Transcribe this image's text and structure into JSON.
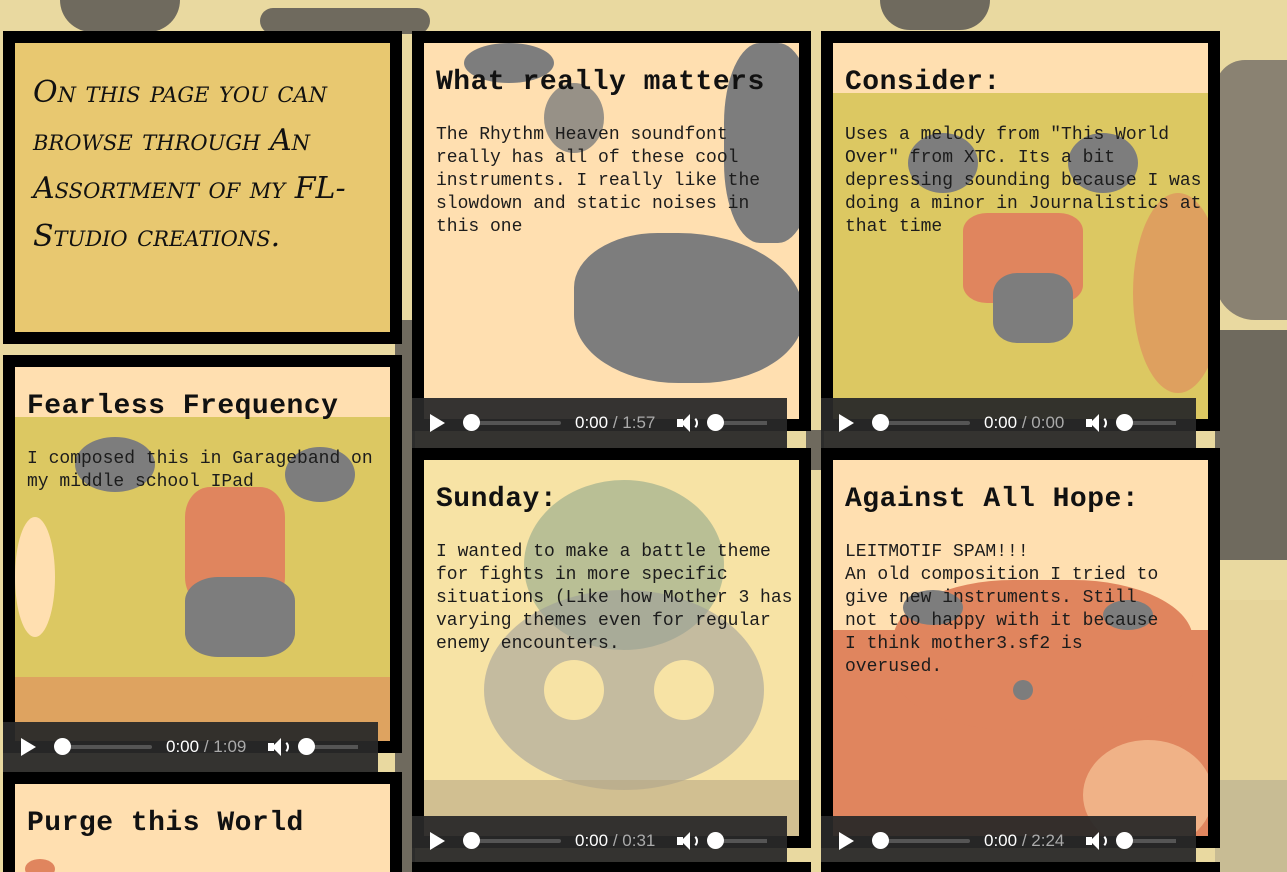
{
  "intro": {
    "text": "On this page you can browse through An Assortment of my FL-Studio creations."
  },
  "cards": [
    {
      "title": "What really matters",
      "description": "The Rhythm Heaven soundfont really has all of these cool instruments. I really like the slowdown and static noises in this one",
      "player": {
        "current": "0:00",
        "separator": "/",
        "duration": "1:57"
      },
      "art_colors": [
        "#ffdfb0",
        "#7d7d7d"
      ]
    },
    {
      "title": "Consider:",
      "description": "Uses a melody from \"This World Over\" from XTC. Its a bit depressing sounding because I was doing a minor in Journalistics at that time",
      "player": {
        "current": "0:00",
        "separator": "/",
        "duration": "0:00"
      },
      "art_colors": [
        "#dcc862",
        "#e0855e",
        "#7d7d7d"
      ]
    },
    {
      "title": "Fearless Frequency",
      "description": "I composed this in Garageband on my middle school IPad",
      "player": {
        "current": "0:00",
        "separator": "/",
        "duration": "1:09"
      },
      "art_colors": [
        "#dcc862",
        "#e0855e",
        "#7d7d7d"
      ]
    },
    {
      "title": "Sunday:",
      "description": "I wanted to make a battle theme for fights in more specific situations (Like how Mother 3 has varying themes even for regular enemy encounters.",
      "player": {
        "current": "0:00",
        "separator": "/",
        "duration": "0:31"
      },
      "art_colors": [
        "#f7e3a5",
        "#9a9a9a",
        "#7c9c86"
      ]
    },
    {
      "title": "Against All Hope:",
      "description": "LEITMOTIF SPAM!!!\nAn old composition I tried to give new instruments. Still not too happy with it because I think mother3.sf2 is overused.",
      "player": {
        "current": "0:00",
        "separator": "/",
        "duration": "2:24"
      },
      "art_colors": [
        "#e0855e",
        "#ffdfb0",
        "#7d7d7d"
      ]
    },
    {
      "title": "Purge this World",
      "description": "",
      "art_colors": [
        "#ffdfb0",
        "#e0855e"
      ]
    }
  ]
}
